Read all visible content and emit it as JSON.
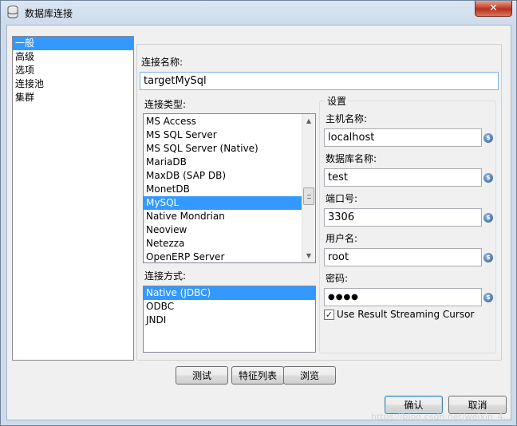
{
  "window": {
    "title": "数据库连接",
    "close_label": "✕"
  },
  "nav": {
    "items": [
      {
        "label": "一般",
        "selected": true
      },
      {
        "label": "高级",
        "selected": false
      },
      {
        "label": "选项",
        "selected": false
      },
      {
        "label": "连接池",
        "selected": false
      },
      {
        "label": "集群",
        "selected": false
      }
    ]
  },
  "general": {
    "conn_name_label": "连接名称:",
    "conn_name_value": "targetMySql",
    "conn_type_label": "连接类型:",
    "conn_types": [
      "MS Access",
      "MS SQL Server",
      "MS SQL Server (Native)",
      "MariaDB",
      "MaxDB (SAP DB)",
      "MonetDB",
      "MySQL",
      "Native Mondrian",
      "Neoview",
      "Netezza",
      "OpenERP Server"
    ],
    "conn_type_selected": "MySQL",
    "access_label": "连接方式:",
    "access_methods": [
      "Native (JDBC)",
      "ODBC",
      "JNDI"
    ],
    "access_selected": "Native (JDBC)"
  },
  "settings": {
    "legend": "设置",
    "host_label": "主机名称:",
    "host_value": "localhost",
    "db_label": "数据库名称:",
    "db_value": "test",
    "port_label": "端口号:",
    "port_value": "3306",
    "user_label": "用户名:",
    "user_value": "root",
    "password_label": "密码:",
    "password_value": "●●●●",
    "streaming_label": "Use Result Streaming Cursor",
    "streaming_checked": true,
    "variable_icon_glyph": "$"
  },
  "buttons": {
    "test": "测试",
    "features": "特征列表",
    "browse": "浏览",
    "ok": "确认",
    "cancel": "取消"
  },
  "watermark": "https://blog.csdn.net/weixin_4...",
  "colors": {
    "selection": "#3399ff",
    "title_bg": "#cfdcea",
    "close_btn": "#c7422d"
  }
}
